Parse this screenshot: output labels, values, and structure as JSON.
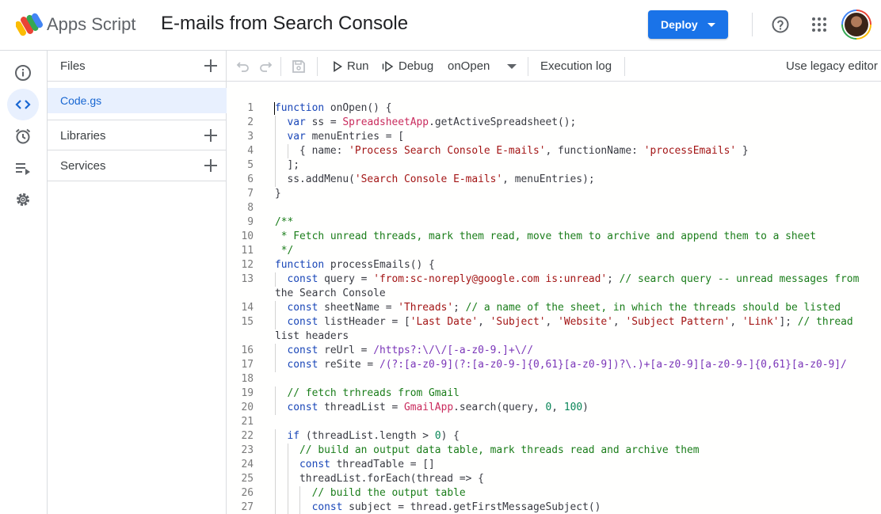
{
  "app": {
    "brand": "Apps Script",
    "project_title": "E-mails from Search Console",
    "deploy_label": "Deploy"
  },
  "files_panel": {
    "files_title": "Files",
    "files": [
      "Code.gs"
    ],
    "libraries_title": "Libraries",
    "services_title": "Services"
  },
  "toolbar": {
    "run_label": "Run",
    "debug_label": "Debug",
    "function_name": "onOpen",
    "execution_log_label": "Execution log",
    "legacy_label": "Use legacy editor"
  },
  "editor": {
    "lines": [
      {
        "n": "1",
        "t": "function onOpen() {"
      },
      {
        "n": "2",
        "t": "  var ss = SpreadsheetApp.getActiveSpreadsheet();"
      },
      {
        "n": "3",
        "t": "  var menuEntries = ["
      },
      {
        "n": "4",
        "t": "    { name: 'Process Search Console E-mails', functionName: 'processEmails' }"
      },
      {
        "n": "5",
        "t": "  ];"
      },
      {
        "n": "6",
        "t": "  ss.addMenu('Search Console E-mails', menuEntries);"
      },
      {
        "n": "7",
        "t": "}"
      },
      {
        "n": "8",
        "t": ""
      },
      {
        "n": "9",
        "t": "/**"
      },
      {
        "n": "10",
        "t": " * Fetch unread threads, mark them read, move them to archive and append them to a sheet"
      },
      {
        "n": "11",
        "t": " */"
      },
      {
        "n": "12",
        "t": "function processEmails() {"
      },
      {
        "n": "13",
        "t": "  const query = 'from:sc-noreply@google.com is:unread'; // search query -- unread messages from",
        "cont": "the Search Console"
      },
      {
        "n": "14",
        "t": "  const sheetName = 'Threads'; // a name of the sheet, in which the threads should be listed"
      },
      {
        "n": "15",
        "t": "  const listHeader = ['Last Date', 'Subject', 'Website', 'Subject Pattern', 'Link']; // thread",
        "cont": "list headers"
      },
      {
        "n": "16",
        "t": "  const reUrl = /https?:\\/\\/[-a-z0-9.]+\\//"
      },
      {
        "n": "17",
        "t": "  const reSite = /(?:[a-z0-9](?:[a-z0-9-]{0,61}[a-z0-9])?\\.)+[a-z0-9][a-z0-9-]{0,61}[a-z0-9]/"
      },
      {
        "n": "18",
        "t": ""
      },
      {
        "n": "19",
        "t": "  // fetch trhreads from Gmail"
      },
      {
        "n": "20",
        "t": "  const threadList = GmailApp.search(query, 0, 100)"
      },
      {
        "n": "21",
        "t": ""
      },
      {
        "n": "22",
        "t": "  if (threadList.length > 0) {"
      },
      {
        "n": "23",
        "t": "    // build an output data table, mark threads read and archive them"
      },
      {
        "n": "24",
        "t": "    const threadTable = []"
      },
      {
        "n": "25",
        "t": "    threadList.forEach(thread => {"
      },
      {
        "n": "26",
        "t": "      // build the output table"
      },
      {
        "n": "27",
        "t": "      const subject = thread.getFirstMessageSubject()"
      }
    ]
  },
  "colors": {
    "accent": "#1a73e8",
    "keyword": "#1a47b8",
    "string": "#a31515",
    "comment": "#1a7d1a",
    "class": "#c92a5c",
    "number": "#098658",
    "regex": "#7a35b8"
  }
}
